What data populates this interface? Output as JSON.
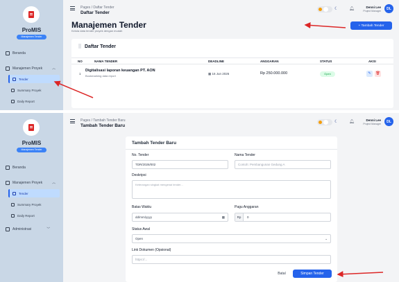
{
  "colors": {
    "accent": "#2563eb",
    "sidebar": "#c9d7e6",
    "annotation_arrow": "#dc2626",
    "open_status": "#16a34a"
  },
  "sidebar": {
    "brand": "ProMIS",
    "brand_sub": "Manajemen Tender",
    "items": [
      {
        "label": "Beranda",
        "icon": "home-icon"
      },
      {
        "label": "Manajemen Proyek",
        "icon": "briefcase-icon"
      }
    ],
    "sub_items": [
      {
        "label": "Tender",
        "icon": "document-icon"
      },
      {
        "label": "Summary Proyek",
        "icon": "chart-icon"
      },
      {
        "label": "Daily Report",
        "icon": "calendar-icon"
      }
    ],
    "extra_item": {
      "label": "Administrasi",
      "icon": "folder-icon"
    }
  },
  "header": {
    "user_name": "Denni Lee",
    "user_role": "Project Manager",
    "avatar_initials": "DL"
  },
  "screen1": {
    "breadcrumb": "Pages  /  Daftar Tender",
    "breadcrumb_title": "Daftar Tender",
    "page_title": "Manajemen Tender",
    "page_subtitle": "Kelola data tender proyek dengan mudah",
    "add_button": "+ Tambah Tender",
    "card_title": "Daftar Tender",
    "columns": [
      "NO",
      "NAMA TENDER",
      "DEADLINE",
      "ANGGARAN",
      "STATUS",
      "AKSI"
    ],
    "rows": [
      {
        "no": "1",
        "name": "Digitalisasi laporan keuangan PT. AON",
        "desc": "Bookmarking data report",
        "deadline": "16 Jun 2026",
        "budget": "Rp 250.000.000",
        "status": "Open"
      }
    ]
  },
  "screen2": {
    "breadcrumb": "Pages  /  Tambah Tender Baru",
    "breadcrumb_title": "Tambah Tender Baru",
    "form_title": "Tambah Tender Baru",
    "fields": {
      "no_tender_label": "No. Tender",
      "no_tender_value": "TDR/2026/002",
      "nama_label": "Nama Tender",
      "nama_placeholder": "Contoh: Pembangunan Gedung A",
      "deskripsi_label": "Deskripsi",
      "deskripsi_placeholder": "Keterangan singkat mengenai tender...",
      "batas_label": "Batas Waktu",
      "batas_placeholder": "dd/mm/yyyy",
      "pagu_label": "Pagu Anggaran",
      "pagu_prefix": "Rp",
      "pagu_placeholder": "0",
      "status_label": "Status Awal",
      "status_value": "Open",
      "link_label": "Link Dokumen (Opsional)",
      "link_placeholder": "https://..."
    },
    "cancel_button": "Batal",
    "save_button": "Simpan Tender"
  }
}
